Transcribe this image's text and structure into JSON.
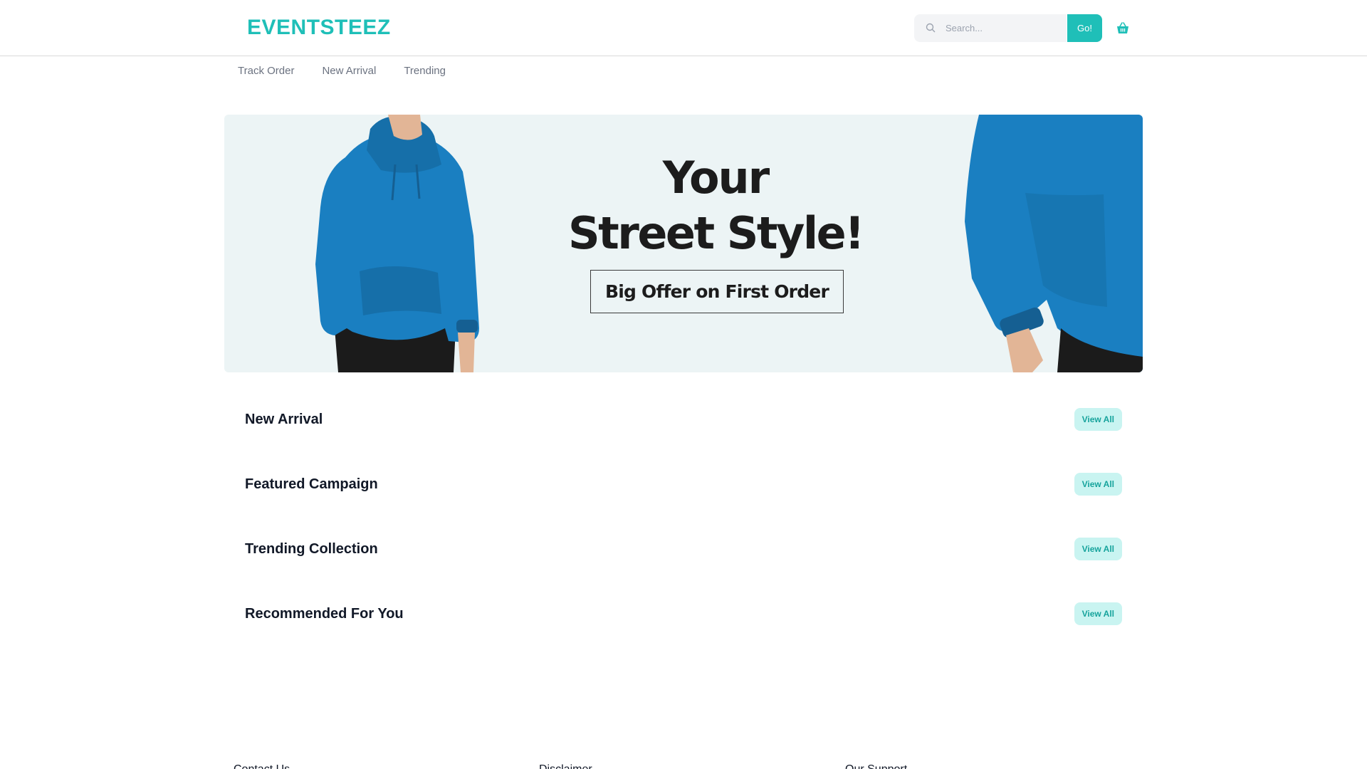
{
  "header": {
    "logo": "EVENTSTEEZ",
    "search": {
      "placeholder": "Search...",
      "value": ""
    },
    "go_label": "Go!",
    "accent_color": "#1fbfb8"
  },
  "nav": {
    "items": [
      {
        "label": "Track Order"
      },
      {
        "label": "New Arrival"
      },
      {
        "label": "Trending"
      }
    ]
  },
  "hero": {
    "line1": "Your",
    "line2": "Street Style!",
    "offer": "Big Offer on First Order",
    "background": "#ecf4f5",
    "garment_color": "#1a7fc1"
  },
  "sections": [
    {
      "title": "New Arrival",
      "action": "View All"
    },
    {
      "title": "Featured Campaign",
      "action": "View All"
    },
    {
      "title": "Trending Collection",
      "action": "View All"
    },
    {
      "title": "Recommended For You",
      "action": "View All"
    }
  ],
  "footer": {
    "columns": [
      {
        "heading": "Contact Us"
      },
      {
        "heading": "Disclaimer"
      },
      {
        "heading": "Our Support"
      }
    ]
  },
  "icons": {
    "search": "search-icon",
    "cart": "basket-icon"
  }
}
